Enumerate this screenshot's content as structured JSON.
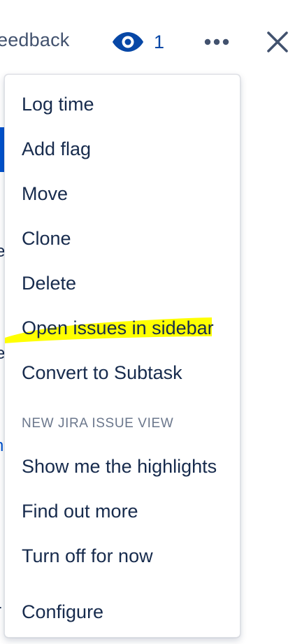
{
  "header": {
    "feedback_label": "eedback",
    "watch_count": "1"
  },
  "colors": {
    "accent": "#0052cc",
    "watch": "#0747a6",
    "text": "#172b4d",
    "subtle": "#42526e",
    "group_label": "#6b778c",
    "highlight": "#ffff00"
  },
  "icons": {
    "watch": "eye-icon",
    "more": "more-horizontal-icon",
    "close": "close-icon"
  },
  "menu": {
    "items": [
      {
        "label": "Log time"
      },
      {
        "label": "Add flag"
      },
      {
        "label": "Move"
      },
      {
        "label": "Clone"
      },
      {
        "label": "Delete"
      },
      {
        "label": "Open issues in sidebar"
      },
      {
        "label": "Convert to Subtask"
      }
    ],
    "group_label": "NEW JIRA ISSUE VIEW",
    "group_items": [
      {
        "label": "Show me the highlights"
      },
      {
        "label": "Find out more"
      },
      {
        "label": "Turn off for now"
      }
    ],
    "footer_item": {
      "label": "Configure"
    }
  },
  "background_fragments": {
    "char_a": "e",
    "char_b": "e",
    "char_c": "n",
    "char_d": "r"
  }
}
